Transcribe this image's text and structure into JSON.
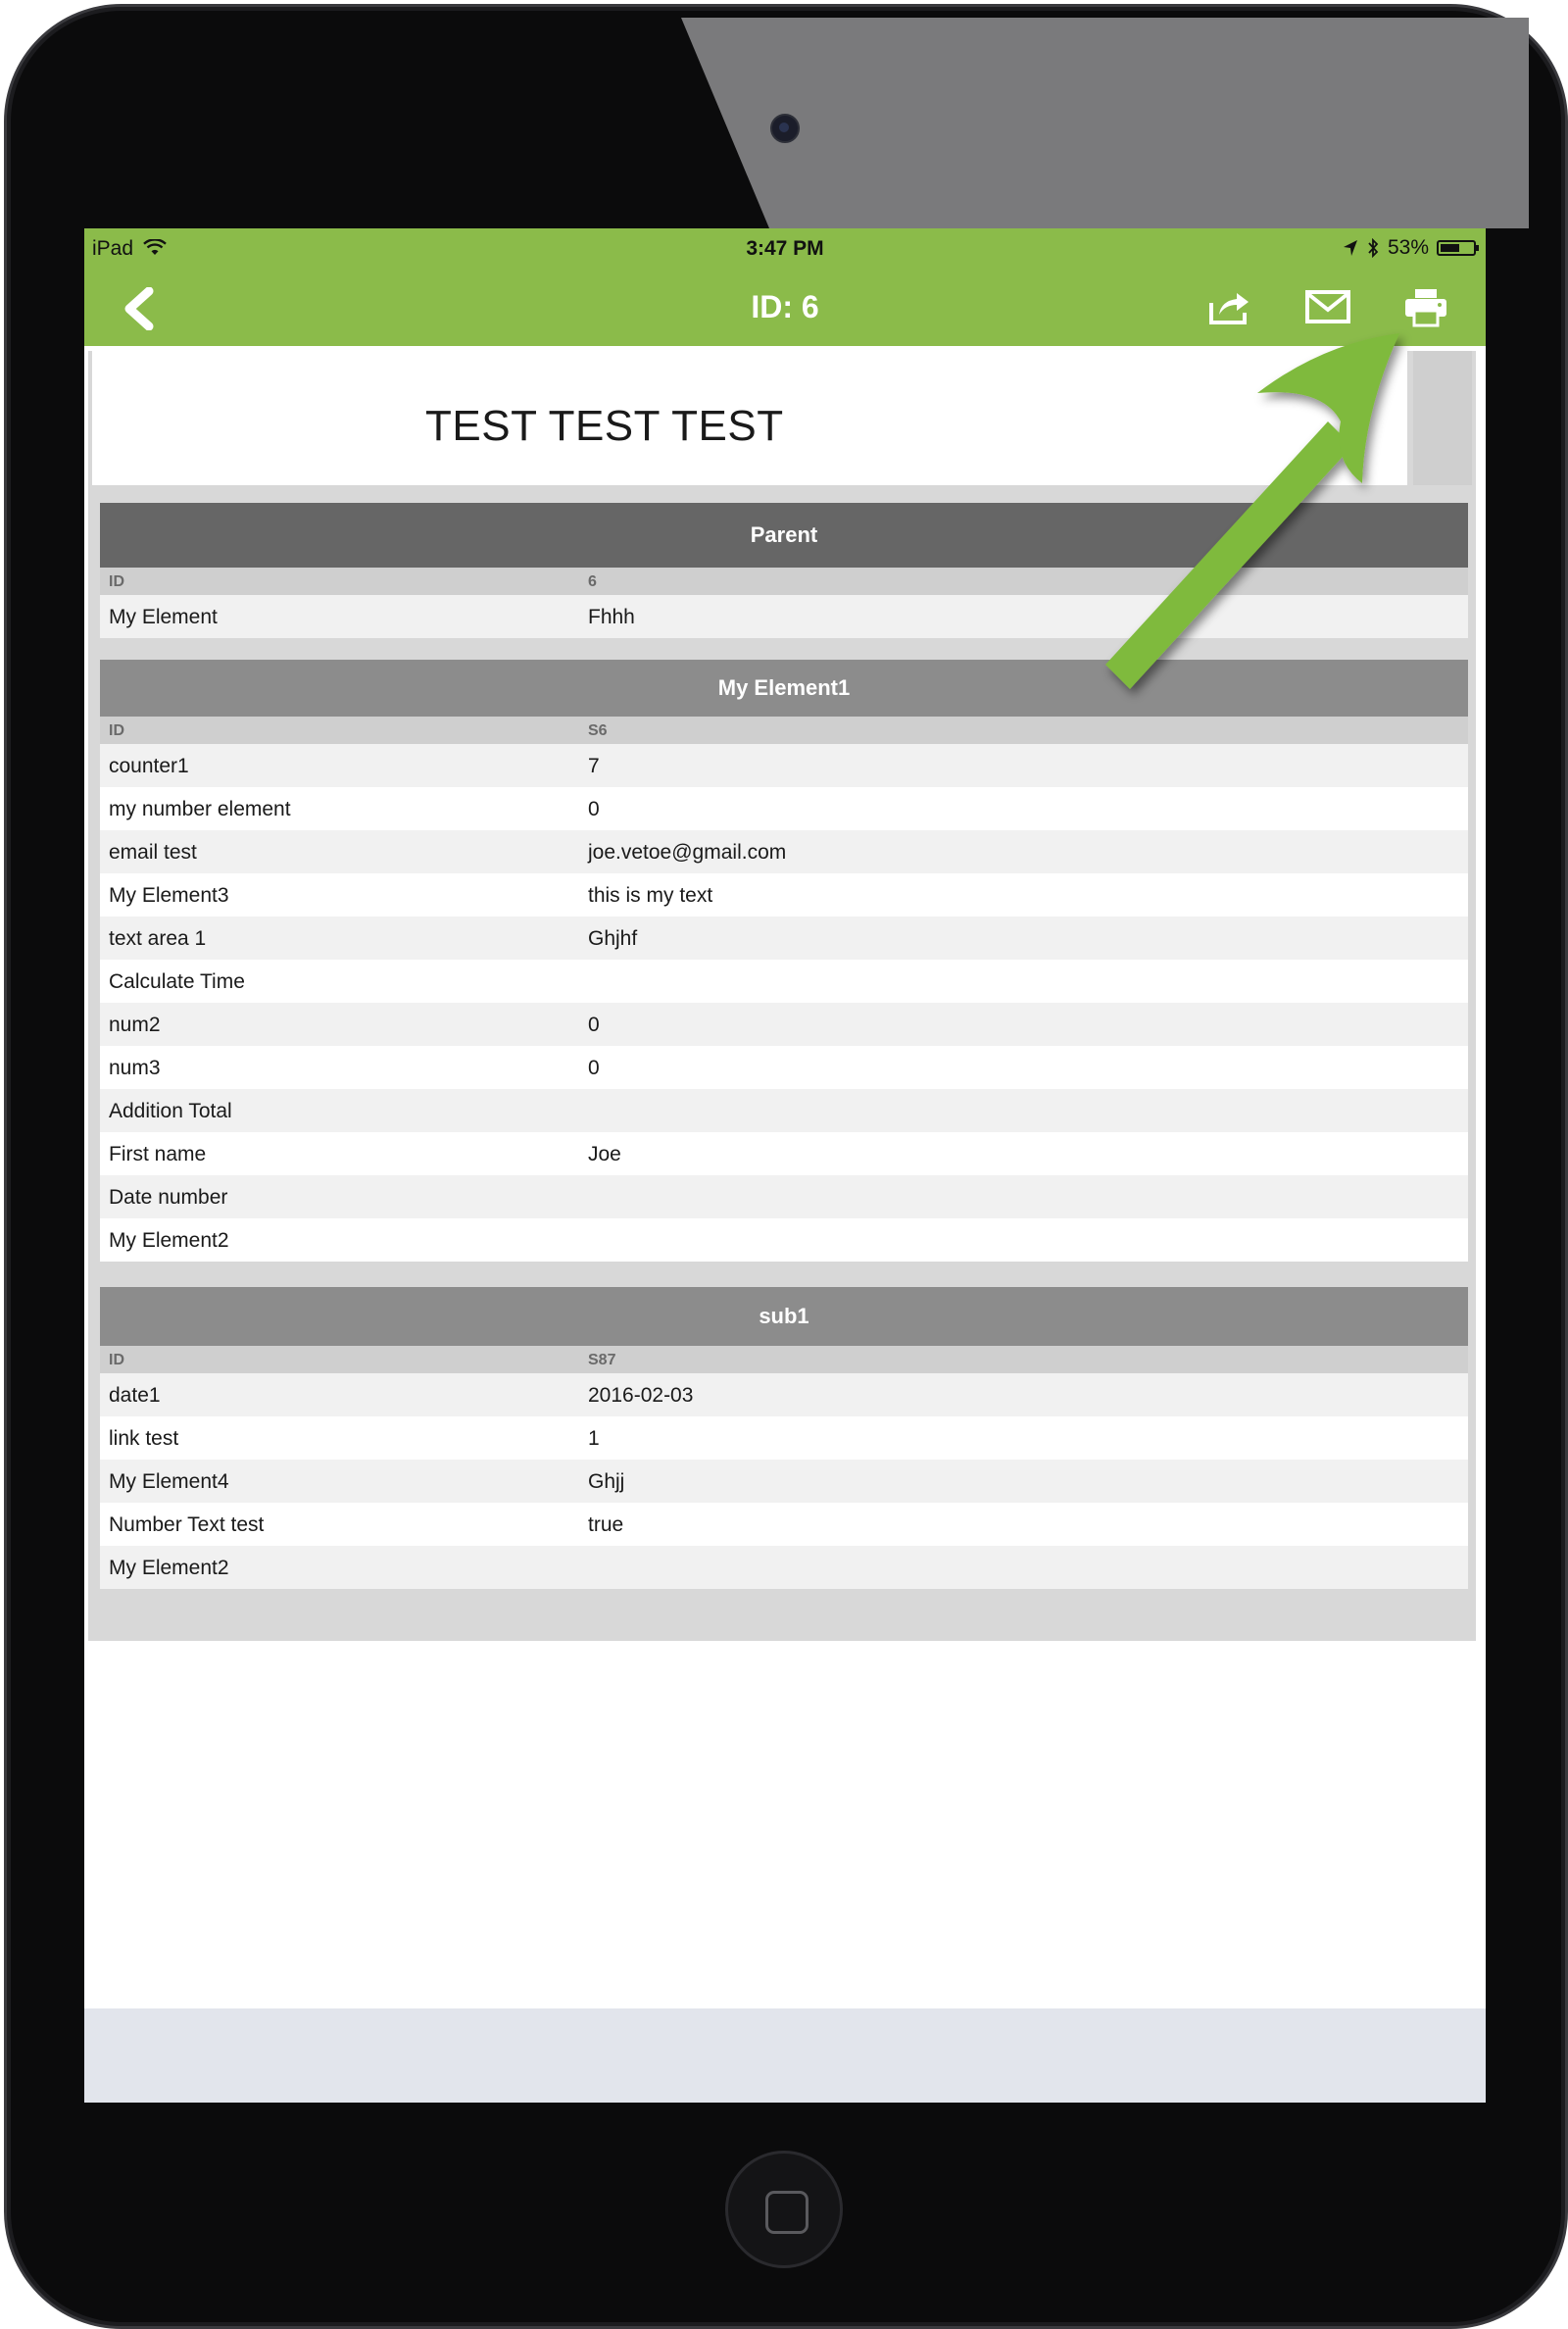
{
  "status_bar": {
    "carrier": "iPad",
    "time": "3:47 PM",
    "battery": "53%",
    "battery_level": 0.53
  },
  "nav": {
    "title": "ID: 6",
    "back_icon": "chevron-left-icon",
    "share_icon": "share-icon",
    "mail_icon": "mail-icon",
    "print_icon": "printer-icon"
  },
  "doc": {
    "title": "TEST TEST TEST"
  },
  "sections": {
    "parent": {
      "title": "Parent",
      "id_label": "ID",
      "id_value": "6",
      "rows": [
        {
          "k": "My Element",
          "v": "Fhhh"
        }
      ]
    },
    "element1": {
      "title": "My Element1",
      "id_label": "ID",
      "id_value": "S6",
      "rows": [
        {
          "k": "counter1",
          "v": "7"
        },
        {
          "k": "my number element",
          "v": "0"
        },
        {
          "k": "email test",
          "v": "joe.vetoe@gmail.com"
        },
        {
          "k": "My Element3",
          "v": "this is my text"
        },
        {
          "k": "text area 1",
          "v": "Ghjhf"
        },
        {
          "k": "Calculate Time",
          "v": ""
        },
        {
          "k": "num2",
          "v": "0"
        },
        {
          "k": "num3",
          "v": "0"
        },
        {
          "k": "Addition Total",
          "v": ""
        },
        {
          "k": "First name",
          "v": "Joe"
        },
        {
          "k": "Date number",
          "v": ""
        },
        {
          "k": "My Element2",
          "v": ""
        }
      ]
    },
    "sub1": {
      "title": "sub1",
      "id_label": "ID",
      "id_value": "S87",
      "rows": [
        {
          "k": "date1",
          "v": "2016-02-03"
        },
        {
          "k": "link test",
          "v": "1"
        },
        {
          "k": "My Element4",
          "v": "Ghjj"
        },
        {
          "k": "Number Text test",
          "v": "true"
        },
        {
          "k": "My Element2",
          "v": ""
        }
      ]
    }
  },
  "colors": {
    "accent": "#8bbb4a",
    "section_dark": "#666666",
    "section": "#8c8c8c",
    "annotation_arrow": "#7fba3c"
  }
}
